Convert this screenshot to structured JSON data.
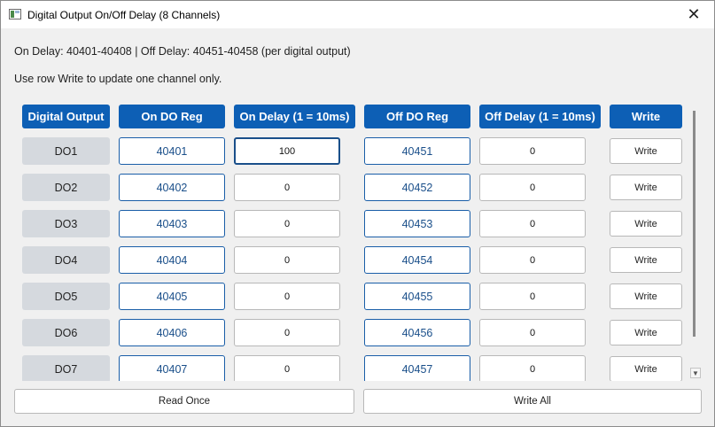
{
  "window": {
    "title": "Digital Output On/Off Delay (8 Channels)",
    "close_glyph": "✕"
  },
  "info": {
    "line1": "On Delay: 40401-40408 | Off Delay: 40451-40458 (per digital output)",
    "line2": "Use row Write to update one channel only."
  },
  "headers": {
    "digital_output": "Digital Output",
    "on_do_reg": "On DO Reg",
    "on_delay": "On Delay (1 = 10ms)",
    "off_do_reg": "Off DO Reg",
    "off_delay": "Off Delay (1 = 10ms)",
    "write": "Write"
  },
  "rows": [
    {
      "name": "DO1",
      "on_reg": "40401",
      "on_delay": "100",
      "off_reg": "40451",
      "off_delay": "0",
      "write": "Write"
    },
    {
      "name": "DO2",
      "on_reg": "40402",
      "on_delay": "0",
      "off_reg": "40452",
      "off_delay": "0",
      "write": "Write"
    },
    {
      "name": "DO3",
      "on_reg": "40403",
      "on_delay": "0",
      "off_reg": "40453",
      "off_delay": "0",
      "write": "Write"
    },
    {
      "name": "DO4",
      "on_reg": "40404",
      "on_delay": "0",
      "off_reg": "40454",
      "off_delay": "0",
      "write": "Write"
    },
    {
      "name": "DO5",
      "on_reg": "40405",
      "on_delay": "0",
      "off_reg": "40455",
      "off_delay": "0",
      "write": "Write"
    },
    {
      "name": "DO6",
      "on_reg": "40406",
      "on_delay": "0",
      "off_reg": "40456",
      "off_delay": "0",
      "write": "Write"
    },
    {
      "name": "DO7",
      "on_reg": "40407",
      "on_delay": "0",
      "off_reg": "40457",
      "off_delay": "0",
      "write": "Write"
    }
  ],
  "buttons": {
    "read_once": "Read Once",
    "write_all": "Write All"
  },
  "colors": {
    "header_bg": "#0d5fb5",
    "register_text": "#1a4f8a"
  }
}
